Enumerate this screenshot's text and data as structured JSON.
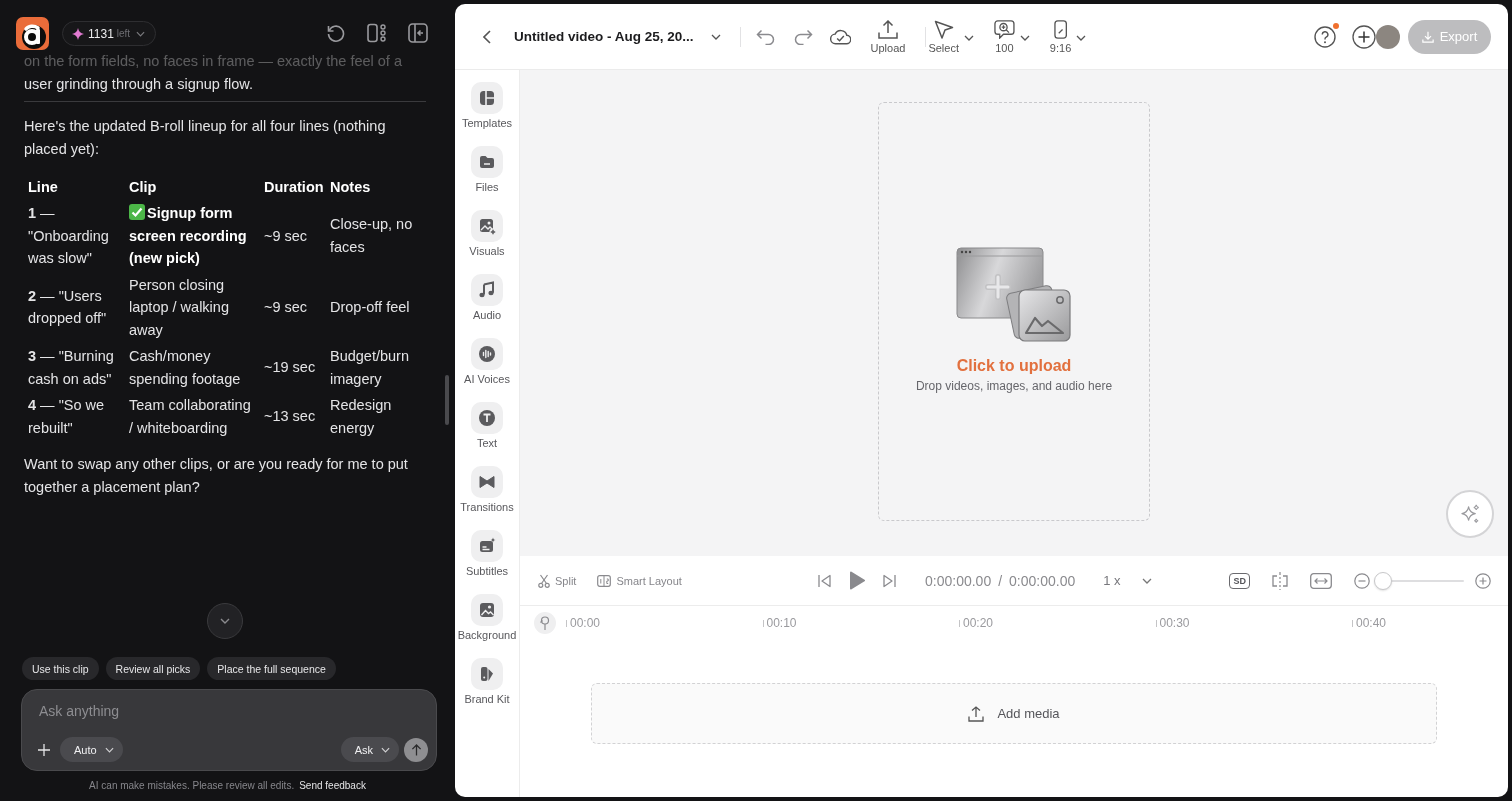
{
  "assistant_panel": {
    "credits": {
      "count": "1131",
      "unit": "left"
    },
    "message": {
      "intro_tail": "on the form fields, no faces in frame — exactly the feel of a user grinding through a signup flow.",
      "lead": "Here's the updated B-roll lineup for all four lines (nothing placed yet):",
      "table": {
        "columns": [
          "Line",
          "Clip",
          "Duration",
          "Notes"
        ],
        "rows": [
          {
            "line": "**1** — \"Onboarding was slow\"",
            "clip": "Signup form screen recording (new pick)",
            "checked": true,
            "duration": "~9 sec",
            "notes": "Close-up, no faces"
          },
          {
            "line": "**2** — \"Users dropped off\"",
            "clip": "Person closing laptop / walking away",
            "checked": false,
            "duration": "~9 sec",
            "notes": "Drop-off feel"
          },
          {
            "line": "**3** — \"Burning cash on ads\"",
            "clip": "Cash/money spending footage",
            "checked": false,
            "duration": "~19 sec",
            "notes": "Budget/burn imagery"
          },
          {
            "line": "**4** — \"So we rebuilt\"",
            "clip": "Team collaborating / whiteboarding",
            "checked": false,
            "duration": "~13 sec",
            "notes": "Redesign energy"
          }
        ]
      },
      "closing": "Want to swap any other clips, or are you ready for me to put together a placement plan?"
    },
    "suggestions": [
      "Use this clip",
      "Review all picks",
      "Place the full sequence"
    ],
    "composer": {
      "placeholder": "Ask anything",
      "mode": "Auto",
      "action": "Ask",
      "send_disabled": true
    },
    "disclaimer": "AI can make mistakes. Please review all edits.",
    "feedback_link": "Send feedback"
  },
  "editor": {
    "title": "Untitled video - Aug 25, 20...",
    "toolbar": [
      {
        "kind": "upload",
        "label": "Upload",
        "dropdown": false
      },
      {
        "kind": "select",
        "label": "Select",
        "dropdown": true
      },
      {
        "kind": "zoom",
        "label": "100",
        "dropdown": true
      },
      {
        "kind": "aspect",
        "label": "9:16",
        "dropdown": true
      }
    ],
    "help": {
      "notification": true
    },
    "export": {
      "label": "Export",
      "disabled": true
    },
    "tools": [
      {
        "kind": "templates",
        "label": "Templates",
        "selected": false
      },
      {
        "kind": "files",
        "label": "Files",
        "selected": false
      },
      {
        "kind": "visuals",
        "label": "Visuals",
        "selected": false
      },
      {
        "kind": "audio",
        "label": "Audio",
        "selected": false
      },
      {
        "kind": "ai_voices",
        "label": "AI Voices",
        "selected": false
      },
      {
        "kind": "text",
        "label": "Text",
        "selected": false
      },
      {
        "kind": "transitions",
        "label": "Transitions",
        "selected": false
      },
      {
        "kind": "subtitles",
        "label": "Subtitles",
        "selected": false
      },
      {
        "kind": "background",
        "label": "Background",
        "selected": false
      },
      {
        "kind": "brand_kit",
        "label": "Brand Kit",
        "selected": false
      }
    ],
    "canvas": {
      "upload_title": "Click to upload",
      "upload_hint": "Drop videos, images, and audio here"
    },
    "timeline": {
      "tools": [
        {
          "kind": "split",
          "label": "Split"
        },
        {
          "kind": "smart_layout",
          "label": "Smart Layout"
        }
      ],
      "current_time": "0:00:00.00",
      "separator": "/",
      "total_time": "0:00:00.00",
      "speed": "1 x",
      "quality": "SD",
      "zoom": {
        "level": 0
      },
      "ruler": [
        "00:00",
        "00:10",
        "00:20",
        "00:30",
        "00:40"
      ],
      "add_media": "Add media"
    }
  }
}
